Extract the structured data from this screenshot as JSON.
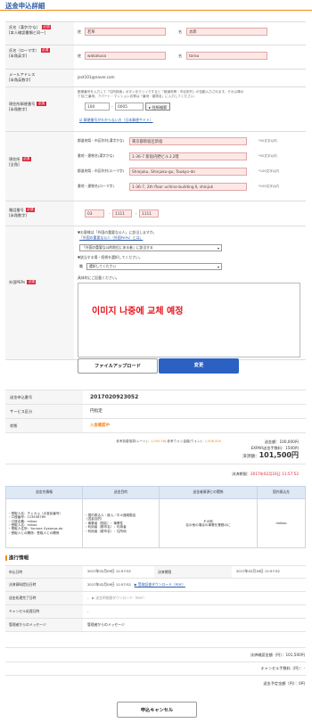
{
  "header": {
    "title": "送金申込詳細"
  },
  "form": {
    "required": "必須",
    "name_kana": {
      "label": "氏名（漢字/かな）",
      "sub": "[本人確認書類と同一]",
      "sei_label": "姓",
      "mei_label": "名",
      "sei": "若草",
      "mei": "太郎"
    },
    "name_roma": {
      "label": "氏名（ローマ字）",
      "sub": "[半角英字]",
      "sei_label": "姓",
      "mei_label": "名",
      "sei": "wakakusa",
      "mei": "tarou"
    },
    "email": {
      "label": "メールアドレス",
      "sub": "[半角英数字]",
      "value": "jest101@naver.com"
    },
    "zip": {
      "label": "現住所郵便番号",
      "sub": "[半角数字]",
      "help1": "郵便番号を入力して「住所検索」ボタンをクリックすると「都道府県・市区町村」が自動入力されます。それ以降の",
      "help2": "丁目/三番地、アパート・マンション名等は「番地・建物名」に入力してください。",
      "zip1": "100",
      "zip2": "0005",
      "search_btn": "住所検索",
      "link": "郵便番号がわからない方（日本郵便サイト）"
    },
    "address": {
      "label": "現住所",
      "sub": "[全角]",
      "rows": [
        {
          "label": "都道府県・市区町村(漢字かな)",
          "value": "東京都新宿区新宿",
          "note": "*50文字以内"
        },
        {
          "label": "番地・建物名(漢字かな)",
          "value": "1-36-7 新宿内野ビル２2階",
          "note": "*50文字以内"
        },
        {
          "label": "都道府県・市区町村(ローマ字)",
          "value": "Shinjuku, Shinjuku-gu, Toukyo-do",
          "note": "*100文字以内"
        },
        {
          "label": "番地・建物名(ローマ字)",
          "value": "1-36-7, 2th floor uchino-building Ⅱ, shinjuk",
          "note": "*100文字以内"
        }
      ]
    },
    "phone": {
      "label": "電話番号",
      "sub": "[半角数字]",
      "p1": "03",
      "p2": "1111",
      "p3": "1111"
    },
    "peps": {
      "label": "外国PEPs",
      "q1": "▼お客様は「外国の重要な公人」に該当しますか。",
      "q1_link": "「外国の重要な公人（外国PEPs）とは」",
      "sel1": "「外国の重要な公的地位にある者」に該当する",
      "q2": "▼該当する場・続柄を選択してください。",
      "rel_label": "職",
      "sel2": "選択してください",
      "q3": "具体的にご記載ください。"
    },
    "overlay": "이미지 나중에 교체 예정",
    "btn_upload": "ファイルアップロード",
    "btn_change": "変更"
  },
  "info": {
    "rows": [
      {
        "k": "送金申込番号",
        "v": "2017020923052"
      },
      {
        "k": "サービス区分",
        "v": "円指定"
      },
      {
        "k": "状態",
        "v": "入金確認中"
      }
    ],
    "rate_line1a": "参考為替換算(レート)：",
    "rate_line1b": "1,005.58",
    "rate_line1c": "/ 参考ウォン金額(ウォン)：",
    "rate_line1d": "1,006,000",
    "send_amount": "送金額：100,000円",
    "fee": "EXPAR送金手数料：1500円",
    "total_label": "決済額：",
    "total": "101,500円",
    "deadline_label": "決済期限：",
    "deadline": "2017年02月16日 11:57:52"
  },
  "table": {
    "headers": [
      "送金先情報",
      "送金目的",
      "送金者資源との関係",
      "国内振込先"
    ],
    "recipient": [
      "・受取人名：チェカョ（大宝民番号）",
      "・口座番号：123456789",
      "・口座名義：mikoo",
      "・受取人名：mikoo",
      "・受取人住所：Yumora Gyeongs-do",
      "・受取人との関係：受取人との関係"
    ],
    "purpose": [
      "・国内振込人・被入／平々援助勘定",
      "（送金目的）",
      "・事業者（国名）：事業性",
      "・利用者（都市名）：利用者",
      "・利用者（都市名）：住所地"
    ],
    "relation": [
      "その他",
      "名の他の場合の事業を業務のに"
    ],
    "bank": "mekoo"
  },
  "progress": {
    "title": "進行情報",
    "apply_label": "申込日時",
    "apply": "2017年02月09日 11:57:52",
    "decide_label": "決済期限",
    "decide": "2017年02月16日 11:57:52",
    "pay_label": "決済資料提出日時",
    "pay": "2017年02月09日 11:57:52",
    "pay_link": "▶ 受取証書ダウンロード（PDF）",
    "done_label": "送金処理完了日時",
    "done_dash": "-",
    "done_link": "▶ 送金明細書ダウンロード（PDF）",
    "cancel_label": "キャンセル処理日時",
    "cancel": "-",
    "msg_label": "管理者からのメッセージ",
    "msg": "管理者からのメッセージ"
  },
  "summary": {
    "pay_amount": "決済確認金額（円）：101,500円",
    "cancel_fee": "キャンセル手数料（円）：-",
    "refund": "返金予定金額（円）：0円"
  },
  "footer": {
    "cancel_btn": "申込キャンセル"
  }
}
